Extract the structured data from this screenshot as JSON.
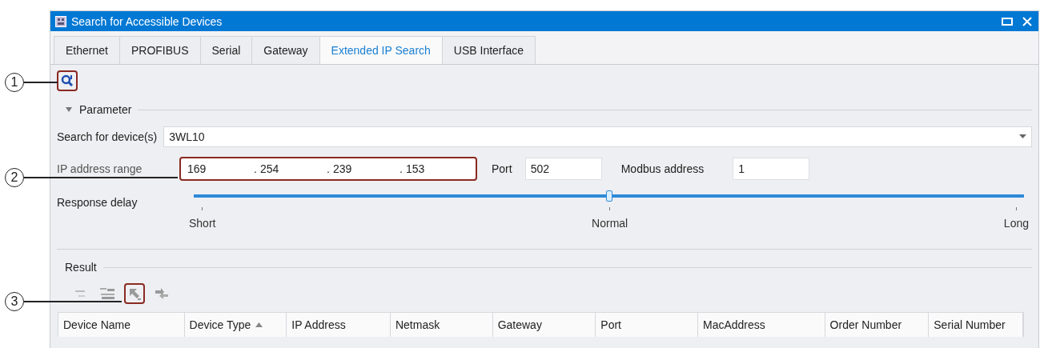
{
  "window": {
    "title": "Search for Accessible Devices"
  },
  "tabs": [
    {
      "label": "Ethernet",
      "selected": false
    },
    {
      "label": "PROFIBUS",
      "selected": false
    },
    {
      "label": "Serial",
      "selected": false
    },
    {
      "label": "Gateway",
      "selected": false
    },
    {
      "label": "Extended IP Search",
      "selected": true
    },
    {
      "label": "USB Interface",
      "selected": false
    }
  ],
  "toolbar": {
    "search_highlighted": true
  },
  "parameter": {
    "title": "Parameter",
    "expanded": true,
    "search_device": {
      "label": "Search for device(s)",
      "value": "3WL10"
    },
    "ip_range": {
      "label": "IP address range",
      "octets": [
        "169",
        "254",
        "239",
        "153"
      ],
      "separator": ".",
      "highlighted": true
    },
    "port": {
      "label": "Port",
      "value": "502"
    },
    "modbus": {
      "label": "Modbus address",
      "value": "1"
    },
    "response_delay": {
      "label": "Response delay",
      "level": 0.5,
      "ticks": [
        "Short",
        "Normal",
        "Long"
      ]
    }
  },
  "result": {
    "title": "Result",
    "tools": [
      {
        "kind": "collapse",
        "highlighted": false
      },
      {
        "kind": "list",
        "highlighted": false
      },
      {
        "kind": "pointer",
        "highlighted": true
      },
      {
        "kind": "arrows",
        "highlighted": false
      }
    ],
    "columns": [
      {
        "label": "Device Name",
        "sorted": false
      },
      {
        "label": "Device Type",
        "sorted": true
      },
      {
        "label": "IP Address",
        "sorted": false
      },
      {
        "label": "Netmask",
        "sorted": false
      },
      {
        "label": "Gateway",
        "sorted": false
      },
      {
        "label": "Port",
        "sorted": false
      },
      {
        "label": "MacAddress",
        "sorted": false
      },
      {
        "label": "Order Number",
        "sorted": false
      },
      {
        "label": "Serial Number",
        "sorted": false
      }
    ]
  },
  "callouts": [
    {
      "number": "1"
    },
    {
      "number": "2"
    },
    {
      "number": "3"
    }
  ]
}
